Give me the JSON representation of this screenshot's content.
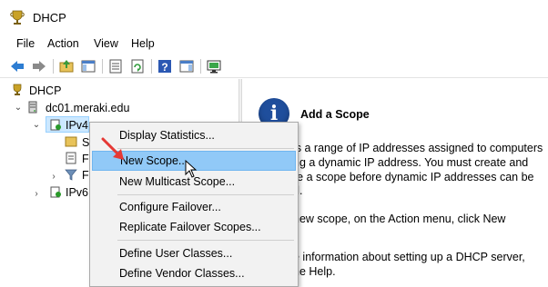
{
  "window": {
    "title": "DHCP",
    "icon": "dhcp-trophy-icon"
  },
  "menu": {
    "file": "File",
    "action": "Action",
    "view": "View",
    "help": "Help"
  },
  "toolbar": {
    "buttons": [
      "back-arrow-icon",
      "forward-arrow-icon",
      "up-folder-icon",
      "show-hide-tree-icon",
      "properties-icon",
      "refresh-icon",
      "help-icon",
      "action-pane-icon",
      "monitor-icon"
    ]
  },
  "tree": {
    "root": "DHCP",
    "server": "dc01.meraki.edu",
    "ipv4": "IPv4",
    "child1_partial": "S",
    "child2_partial": "F",
    "child3_partial": "F",
    "ipv6": "IPv6"
  },
  "right_pane": {
    "heading": "Add a Scope",
    "lines": [
      "is a range of IP addresses assigned to computers",
      "ng a dynamic IP address. You must create and",
      "re a scope before dynamic IP addresses can be",
      "d.",
      "new scope, on the Action menu, click New",
      "e information about setting up a DHCP server,",
      "he Help."
    ]
  },
  "context_menu": {
    "items": [
      "Display Statistics...",
      "New Scope...",
      "New Multicast Scope...",
      "Configure Failover...",
      "Replicate Failover Scopes...",
      "Define User Classes...",
      "Define Vendor Classes..."
    ],
    "highlighted": "New Scope..."
  },
  "colors": {
    "highlight": "#91c9f7",
    "selection": "#cce8ff",
    "info_icon": "#1f4e9c",
    "annotation_arrow": "#e53935"
  }
}
